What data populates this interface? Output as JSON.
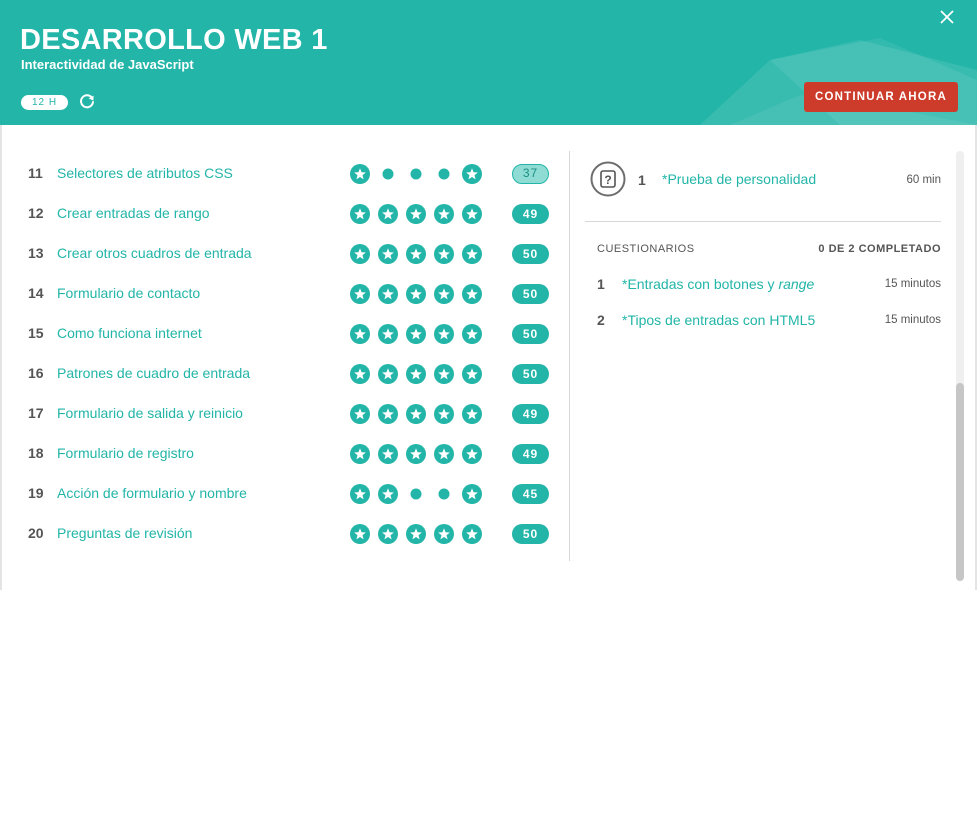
{
  "header": {
    "title": "DESARROLLO WEB 1",
    "subtitle": "Interactividad de JavaScript",
    "hours_badge": "12 H",
    "continue_label": "CONTINUAR AHORA",
    "accent_color": "#22b5a8",
    "button_color": "#cd3c2a"
  },
  "icons": {
    "refresh": "refresh-icon",
    "close": "close-icon",
    "star": "star-icon",
    "exam": "question-mark-icon"
  },
  "lessons": [
    {
      "num": "11",
      "title": "Selectores de atributos CSS",
      "stars": [
        1,
        0,
        0,
        0,
        1
      ],
      "score": "37",
      "partial": true
    },
    {
      "num": "12",
      "title": "Crear entradas de rango",
      "stars": [
        1,
        1,
        1,
        1,
        1
      ],
      "score": "49",
      "partial": false
    },
    {
      "num": "13",
      "title": "Crear otros cuadros de entrada",
      "stars": [
        1,
        1,
        1,
        1,
        1
      ],
      "score": "50",
      "partial": false
    },
    {
      "num": "14",
      "title": "Formulario de contacto",
      "stars": [
        1,
        1,
        1,
        1,
        1
      ],
      "score": "50",
      "partial": false
    },
    {
      "num": "15",
      "title": "Como funciona internet",
      "stars": [
        1,
        1,
        1,
        1,
        1
      ],
      "score": "50",
      "partial": false
    },
    {
      "num": "16",
      "title": "Patrones de cuadro de entrada",
      "stars": [
        1,
        1,
        1,
        1,
        1
      ],
      "score": "50",
      "partial": false
    },
    {
      "num": "17",
      "title": "Formulario de salida y reinicio",
      "stars": [
        1,
        1,
        1,
        1,
        1
      ],
      "score": "49",
      "partial": false
    },
    {
      "num": "18",
      "title": "Formulario de registro",
      "stars": [
        1,
        1,
        1,
        1,
        1
      ],
      "score": "49",
      "partial": false
    },
    {
      "num": "19",
      "title": "Acción de formulario y nombre",
      "stars": [
        1,
        1,
        0,
        0,
        1
      ],
      "score": "45",
      "partial": false
    },
    {
      "num": "20",
      "title": "Preguntas de revisión",
      "stars": [
        1,
        1,
        1,
        1,
        1
      ],
      "score": "50",
      "partial": false
    }
  ],
  "exam": {
    "num": "1",
    "title": "*Prueba de personalidad",
    "duration": "60 min"
  },
  "quizzes": {
    "header": "CUESTIONARIOS",
    "progress": "0 DE 2 COMPLETADO",
    "items": [
      {
        "num": "1",
        "title": "*Entradas con botones y ",
        "title_em": "range",
        "duration": "15 minutos"
      },
      {
        "num": "2",
        "title": "*Tipos de entradas con HTML5",
        "title_em": "",
        "duration": "15 minutos"
      }
    ]
  }
}
